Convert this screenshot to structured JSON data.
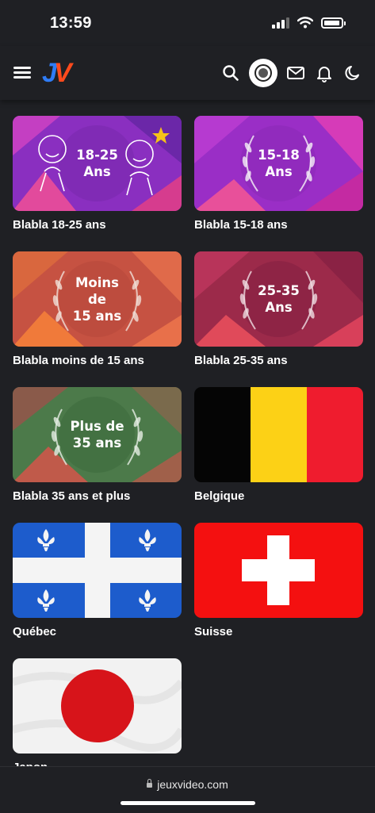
{
  "status_bar": {
    "time": "13:59"
  },
  "header": {
    "logo_j": "J",
    "logo_v": "V",
    "icons": [
      "menu-icon",
      "search-icon",
      "avatar",
      "mail-icon",
      "bell-icon",
      "moon-icon"
    ]
  },
  "forums": [
    {
      "label": "Blabla 18-25 ans",
      "badge": [
        "18-25",
        "Ans"
      ]
    },
    {
      "label": "Blabla 15-18 ans",
      "badge": [
        "15-18",
        "Ans"
      ]
    },
    {
      "label": "Blabla moins de 15 ans",
      "badge": [
        "Moins",
        "de",
        "15 ans"
      ]
    },
    {
      "label": "Blabla 25-35 ans",
      "badge": [
        "25-35",
        "Ans"
      ]
    },
    {
      "label": "Blabla 35 ans et plus",
      "badge": [
        "Plus de",
        "35 ans"
      ]
    },
    {
      "label": "Belgique"
    },
    {
      "label": "Québec"
    },
    {
      "label": "Suisse"
    },
    {
      "label": "Japon"
    }
  ],
  "bottom_bar": {
    "url": "jeuxvideo.com"
  },
  "colors": {
    "background": "#1f2024",
    "logo_j": "#2f7cf6",
    "logo_v": "#ff4a1c"
  }
}
